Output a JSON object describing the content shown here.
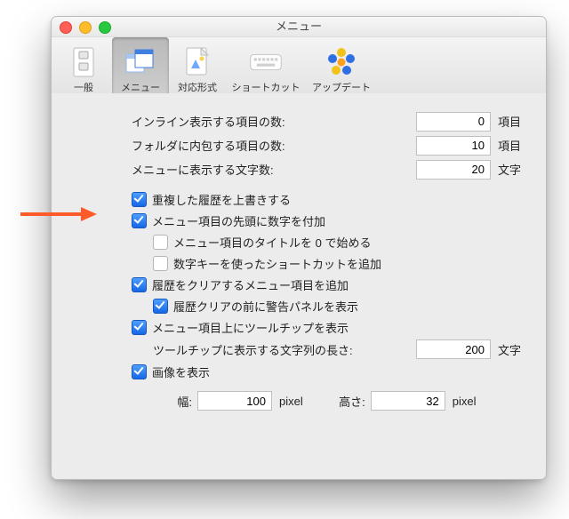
{
  "window": {
    "title": "メニュー"
  },
  "toolbar": {
    "items": [
      {
        "key": "general",
        "label": "一般",
        "icon": "switches-icon"
      },
      {
        "key": "menu",
        "label": "メニュー",
        "icon": "windows-icon",
        "selected": true
      },
      {
        "key": "format",
        "label": "対応形式",
        "icon": "appfile-icon"
      },
      {
        "key": "shortcut",
        "label": "ショートカット",
        "icon": "keyboard-icon"
      },
      {
        "key": "update",
        "label": "アップデート",
        "icon": "flower-icon"
      }
    ]
  },
  "fields": {
    "inline_count": {
      "label": "インライン表示する項目の数:",
      "value": "0",
      "unit": "項目"
    },
    "folder_count": {
      "label": "フォルダに内包する項目の数:",
      "value": "10",
      "unit": "項目"
    },
    "char_count": {
      "label": "メニューに表示する文字数:",
      "value": "20",
      "unit": "文字"
    },
    "tooltip_len": {
      "label": "ツールチップに表示する文字列の長さ:",
      "value": "200",
      "unit": "文字"
    },
    "width": {
      "label": "幅:",
      "value": "100",
      "unit": "pixel"
    },
    "height": {
      "label": "高さ:",
      "value": "32",
      "unit": "pixel"
    }
  },
  "checks": {
    "overwrite_dup": {
      "label": "重複した履歴を上書きする",
      "checked": true
    },
    "prefix_number": {
      "label": "メニュー項目の先頭に数字を付加",
      "checked": true
    },
    "title_zero": {
      "label": "メニュー項目のタイトルを 0 で始める",
      "checked": false
    },
    "numkey_shortcut": {
      "label": "数字キーを使ったショートカットを追加",
      "checked": false
    },
    "add_clear_item": {
      "label": "履歴をクリアするメニュー項目を追加",
      "checked": true
    },
    "warn_before": {
      "label": "履歴クリアの前に警告パネルを表示",
      "checked": true
    },
    "show_tooltip": {
      "label": "メニュー項目上にツールチップを表示",
      "checked": true
    },
    "show_image": {
      "label": "画像を表示",
      "checked": true
    }
  }
}
